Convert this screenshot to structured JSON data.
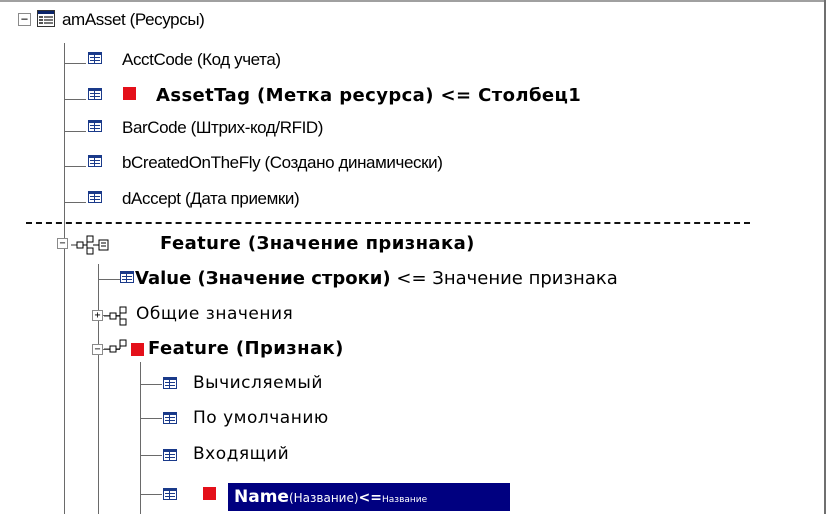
{
  "tree": {
    "root": {
      "label": "amAsset (Ресурсы)",
      "expander": "−",
      "icon": "table-icon"
    },
    "fields": [
      {
        "label": "AcctCode (Код учета)",
        "icon": "field-icon"
      },
      {
        "label": "AssetTag (Метка ресурса)  <=  Столбец1",
        "icon": "field-icon",
        "mandatory": true
      },
      {
        "label": "BarCode (Штрих-код/RFID)",
        "icon": "field-icon"
      },
      {
        "label": "bCreatedOnTheFly (Создано динамически)",
        "icon": "field-icon"
      },
      {
        "label": "dAccept (Дата приемки)",
        "icon": "field-icon"
      }
    ],
    "feature_value": {
      "label": "Feature (Значение признака)",
      "expander": "−",
      "icon": "link-table-icon",
      "value_field": {
        "label": "Value (Значение строки)",
        "mapping": "<= Значение признака"
      },
      "common_values": {
        "label": "Общие значения",
        "expander": "+"
      },
      "feature": {
        "label": "Feature (Признак)",
        "expander": "−",
        "mandatory": true,
        "children": [
          {
            "label": "Вычисляемый"
          },
          {
            "label": "По умолчанию"
          },
          {
            "label": "Входящий"
          }
        ],
        "selected": {
          "name": "Name",
          "desc": "(Название)",
          "arrow": "<=",
          "mapping": "Название",
          "mandatory": true
        }
      }
    }
  },
  "colors": {
    "selection": "#000080",
    "mandatory": "#e4101a",
    "field_icon": "#1a3a8a"
  }
}
